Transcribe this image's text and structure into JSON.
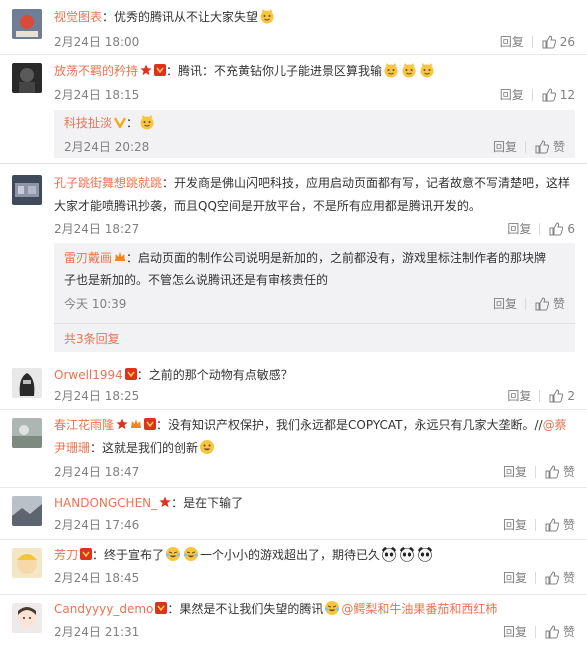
{
  "comments": [
    {
      "user": "视觉图表",
      "text": "：优秀的腾讯从不让大家失望",
      "time": "2月24日 18:00",
      "reply": "回复",
      "likes": "26"
    },
    {
      "user": "放荡不羁的矜持",
      "text": "：腾讯：不充黄钻你儿子能进景区算我输",
      "time": "2月24日 18:15",
      "reply": "回复",
      "likes": "12",
      "sub": {
        "user": "科技扯淡",
        "text": "：",
        "time": "2月24日 20:28",
        "reply": "回复",
        "like_label": "赞"
      }
    },
    {
      "user": "孔子跳街舞想跳就跳",
      "text_line1": "：开发商是佛山闪吧科技，应用启动页面都有写，记者故意不写清楚吧，这样",
      "text_line2": "大家才能喷腾讯抄袭，而且QQ空间是开放平台，不是所有应用都是腾讯开发的。",
      "time": "2月24日 18:27",
      "reply": "回复",
      "likes": "6",
      "sub": {
        "user": "雷刃戴画",
        "text_line1": "：启动页面的制作公司说明是新加的，之前都没有，游戏里标注制作者的那块牌",
        "text_line2": "子也是新加的。不管怎么说腾讯还是有审核责任的",
        "time": "今天 10:39",
        "reply": "回复",
        "like_label": "赞",
        "more": "共3条回复"
      }
    },
    {
      "user": "Orwell1994",
      "text": "：之前的那个动物有点敏感？",
      "time": "2月24日 18:25",
      "reply": "回复",
      "likes": "2"
    },
    {
      "user": "春江花雨隆",
      "text_line1": "：没有知识产权保护，我们永远都是COPYCAT，永远只有几家大垄断。//",
      "mention1": "@蔡",
      "mention2": "尹珊珊",
      "text_line2": "：这就是我们的创新",
      "time": "2月24日 18:47",
      "reply": "回复",
      "like_label": "赞"
    },
    {
      "user": "HANDONGCHEN_",
      "text": "：是在下输了",
      "time": "2月24日 17:46",
      "reply": "回复",
      "like_label": "赞"
    },
    {
      "user": "芳刀",
      "text_a": "：终于宣布了",
      "text_b": "一个小小的游戏超出了，期待已久",
      "time": "2月24日 18:45",
      "reply": "回复",
      "like_label": "赞"
    },
    {
      "user": "Candyyyy_demo",
      "text": "：果然是不让我们失望的腾讯",
      "mention": "@鳄梨和牛油果番茄和西红柿",
      "time": "2月24日 21:31",
      "reply": "回复",
      "like_label": "赞"
    }
  ],
  "colors": {
    "username": "#eb7350",
    "meta": "#808080",
    "sub_bg": "#f2f2f5",
    "vip_red": "#e0311e",
    "star_orange": "#f0861d",
    "emoji_yellow": "#f7c541"
  },
  "icons": [
    "thumbs-up-icon",
    "vip-badge-icon",
    "star-badge-icon",
    "smiley-cat-emoji",
    "laugh-cry-emoji",
    "panda-emoji",
    "grin-emoji",
    "verified-v-icon"
  ]
}
